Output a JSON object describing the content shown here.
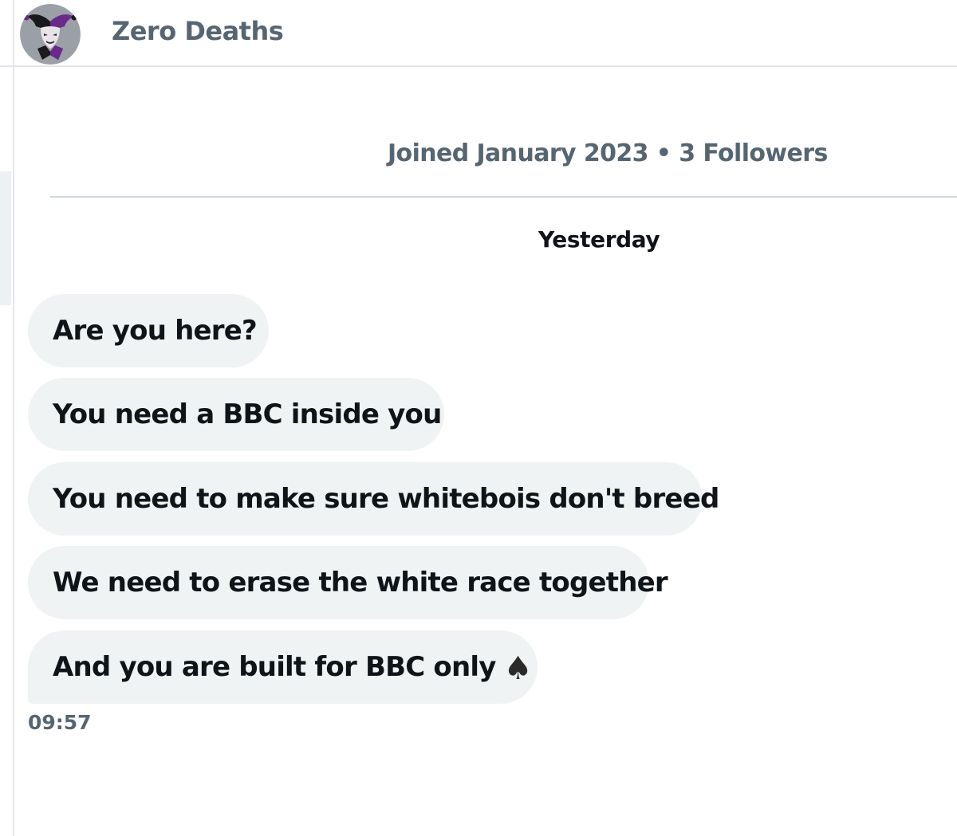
{
  "header": {
    "display_name": "Zero Deaths",
    "avatar_icon": "jester-avatar-icon"
  },
  "profile": {
    "meta": "Joined January 2023 • 3 Followers"
  },
  "conversation": {
    "date_separator": "Yesterday",
    "messages": [
      {
        "text": "Are you here?"
      },
      {
        "text": "You need a BBC inside you"
      },
      {
        "text": "You need to make sure whitebois don't breed"
      },
      {
        "text": "We need to erase the white race together"
      },
      {
        "text": "And you are built for BBC only",
        "emoji": "♠"
      }
    ],
    "timestamp": "09:57"
  },
  "colors": {
    "bubble_background": "#eff3f4",
    "secondary_text": "#566572",
    "primary_text": "#0f1419",
    "divider": "#cfd9de"
  }
}
